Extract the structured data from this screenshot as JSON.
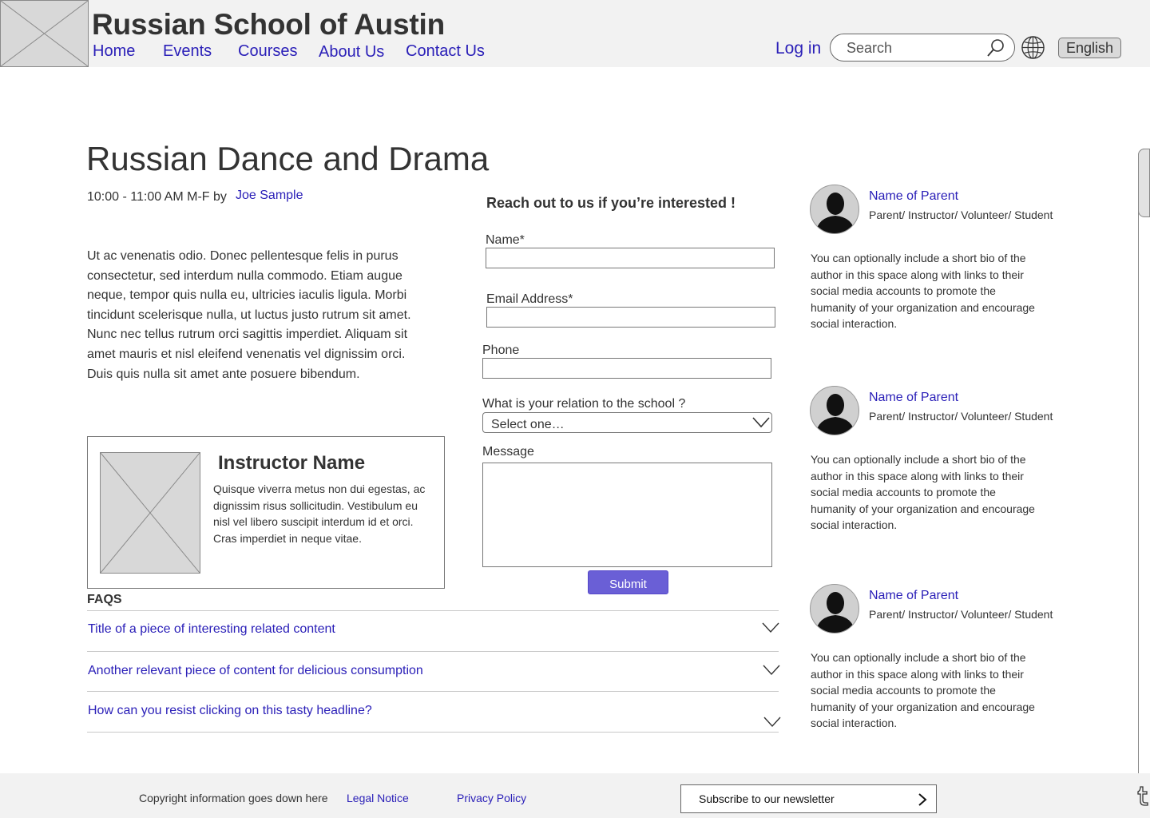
{
  "header": {
    "site_title": "Russian School of Austin",
    "nav": [
      {
        "label": "Home"
      },
      {
        "label": "Events"
      },
      {
        "label": "Courses"
      },
      {
        "label": "About Us"
      },
      {
        "label": "Contact Us"
      }
    ],
    "login_label": "Log in",
    "search_placeholder": "Search",
    "language_label": "English"
  },
  "main": {
    "title": "Russian Dance and Drama",
    "schedule": "10:00 - 11:00 AM M-F by",
    "author": "Joe Sample",
    "description": "Ut ac venenatis odio. Donec pellentesque felis in purus consectetur, sed interdum nulla commodo. Etiam augue neque, tempor quis nulla eu, ultricies iaculis ligula. Morbi tincidunt scelerisque nulla, ut luctus justo rutrum sit amet. Nunc nec tellus rutrum orci sagittis imperdiet. Aliquam sit amet mauris et nisl eleifend venenatis vel dignissim orci. Duis quis nulla sit amet ante posuere bibendum."
  },
  "instructor": {
    "name": "Instructor Name",
    "bio": "Quisque viverra metus non dui egestas, ac dignissim risus sollicitudin. Vestibulum eu nisl vel libero suscipit interdum id et orci. Cras imperdiet in neque vitae."
  },
  "faqs": {
    "heading": "FAQS",
    "items": [
      {
        "title": "Title of a piece of interesting related content"
      },
      {
        "title": "Another relevant piece of content for delicious consumption"
      },
      {
        "title": "How can you resist clicking on this tasty headline?"
      }
    ]
  },
  "form": {
    "heading": "Reach out to us if you’re interested !",
    "name_label": "Name*",
    "name_value": "",
    "email_label": "Email Address*",
    "email_value": "",
    "phone_label": "Phone",
    "phone_value": "",
    "relation_label": "What is your relation to the school ?",
    "relation_value": "Select one…",
    "message_label": "Message",
    "message_value": "",
    "submit_label": "Submit"
  },
  "profiles": [
    {
      "name": "Name of Parent",
      "role": "Parent/ Instructor/ Volunteer/ Student",
      "bio": "You can optionally include a short bio of the author in this space along with links to their social media accounts to promote the humanity of your organization and encourage social interaction."
    },
    {
      "name": "Name of Parent",
      "role": "Parent/ Instructor/ Volunteer/ Student",
      "bio": "You can optionally include a short bio of the author in this space along with links to their social media accounts to promote the humanity of your organization and encourage social interaction."
    },
    {
      "name": "Name of Parent",
      "role": "Parent/ Instructor/ Volunteer/ Student",
      "bio": "You can optionally include a short bio of the author in this space along with links to their social media accounts to promote the humanity of your organization and encourage social interaction."
    }
  ],
  "footer": {
    "copyright": "Copyright information goes down here",
    "legal_label": "Legal Notice",
    "privacy_label": "Privacy Policy",
    "newsletter_label": "Subscribe to our newsletter"
  },
  "icons": {
    "logo": "image-placeholder",
    "search": "search-icon",
    "globe": "globe-icon",
    "avatar": "person-silhouette-icon",
    "chevron": "chevron-down-icon",
    "arrow": "chevron-right-icon",
    "social": "tumblr-icon"
  },
  "colors": {
    "link": "#2b20b8",
    "header_bg": "#f2f2f2",
    "submit_bg": "#6a5fd6",
    "text": "#333333"
  }
}
